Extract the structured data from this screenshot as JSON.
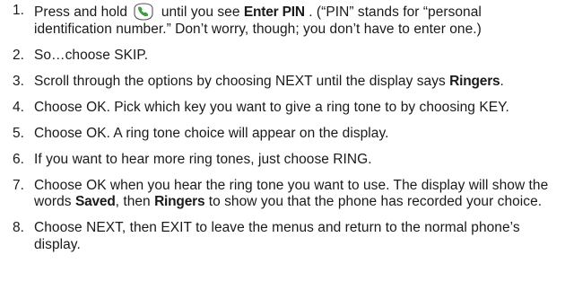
{
  "steps": [
    {
      "number": "1.",
      "text_before": "Press and hold",
      "icon": "power-end-key-icon",
      "text_mid": " until you see ",
      "bold1": "Enter PIN",
      "text_after": ". (“PIN” stands for “personal identification number.” Don’t worry, though; you don’t have to enter one.)"
    },
    {
      "number": "2.",
      "text": "So…choose SKIP."
    },
    {
      "number": "3.",
      "text_before": "Scroll through the options by choosing NEXT until the display says ",
      "bold1": "Ringers",
      "text_after": "."
    },
    {
      "number": "4.",
      "text": "Choose OK. Pick which key you want to give a ring tone to by choosing KEY."
    },
    {
      "number": "5.",
      "text": "Choose OK. A ring tone choice will appear on the display."
    },
    {
      "number": "6.",
      "text": "If you want to hear more ring tones, just choose RING."
    },
    {
      "number": "7.",
      "text_before": "Choose OK when you hear the ring tone you want to use. The display will show the words ",
      "bold1": "Saved",
      "text_mid": ", then ",
      "bold2": "Ringers",
      "text_after": " to show you that the phone has recorded your choice."
    },
    {
      "number": "8.",
      "text": "Choose NEXT, then EXIT to leave the menus and return to the normal phone’s display."
    }
  ],
  "colors": {
    "icon_fill": "#ffffff",
    "icon_stroke": "#555555",
    "icon_accent": "#3aa33a"
  }
}
